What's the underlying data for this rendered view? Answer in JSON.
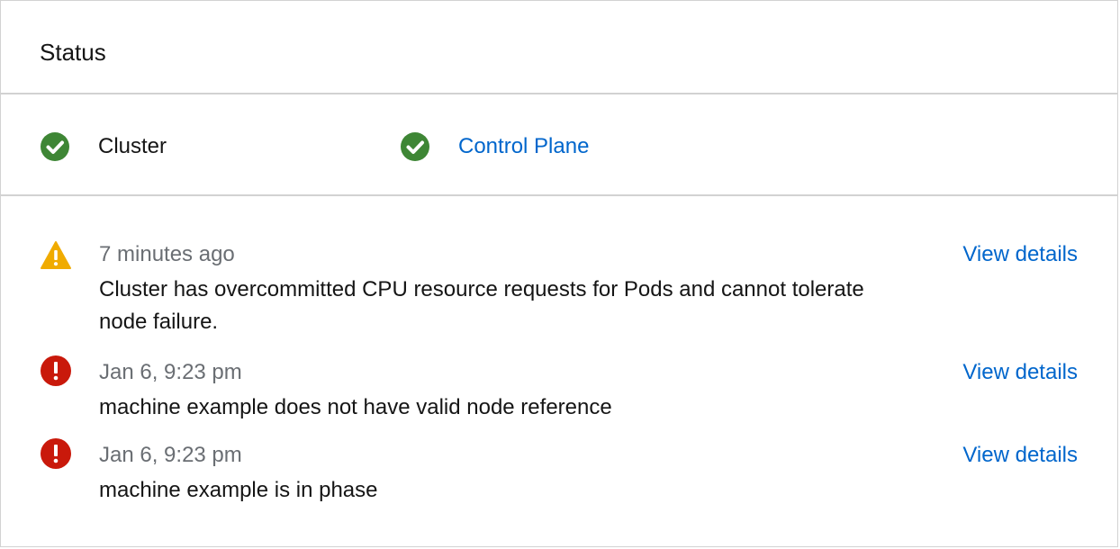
{
  "card": {
    "title": "Status"
  },
  "health": [
    {
      "label": "Cluster",
      "status": "ok",
      "is_link": false
    },
    {
      "label": "Control Plane",
      "status": "ok",
      "is_link": true
    }
  ],
  "alerts": [
    {
      "severity": "warning",
      "time": "7 minutes ago",
      "message": "Cluster has overcommitted CPU resource requests for Pods and cannot tolerate node failure.",
      "action": "View details"
    },
    {
      "severity": "critical",
      "time": "Jan 6, 9:23 pm",
      "message": "machine example does not have valid node reference",
      "action": "View details"
    },
    {
      "severity": "critical",
      "time": "Jan 6, 9:23 pm",
      "message": "machine example is in phase",
      "action": "View details"
    }
  ],
  "colors": {
    "success": "#3e8635",
    "warning": "#f0ab00",
    "danger": "#c9190b",
    "link": "#0066cc",
    "border": "#d2d2d2"
  }
}
